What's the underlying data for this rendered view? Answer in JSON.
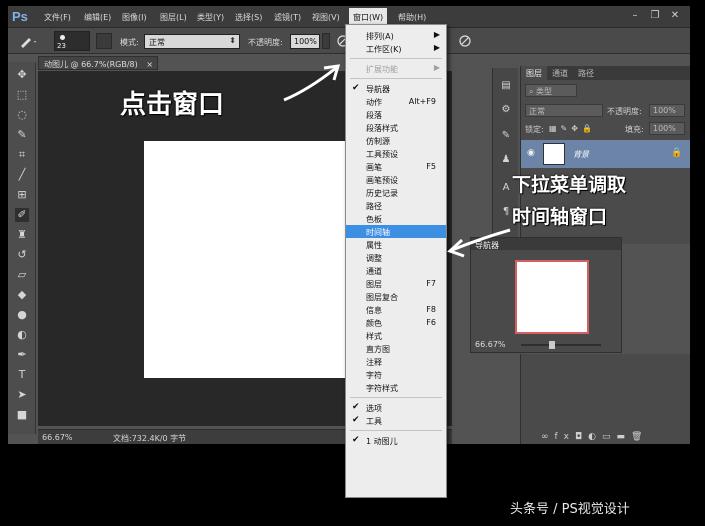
{
  "app": {
    "logo": "Ps",
    "window_controls": [
      "–",
      "❐",
      "✕"
    ]
  },
  "menubar": {
    "items": [
      {
        "label": "文件(F)"
      },
      {
        "label": "编辑(E)"
      },
      {
        "label": "图像(I)"
      },
      {
        "label": "图层(L)"
      },
      {
        "label": "类型(Y)"
      },
      {
        "label": "选择(S)"
      },
      {
        "label": "滤镜(T)"
      },
      {
        "label": "视图(V)"
      },
      {
        "label": "窗口(W)"
      },
      {
        "label": "帮助(H)"
      }
    ],
    "active_index": 8
  },
  "options": {
    "brush_size": "23",
    "mode_label": "模式:",
    "mode_value": "正常",
    "opacity_label": "不透明度:",
    "opacity_value": "100%"
  },
  "document": {
    "tab_title": "动图儿 @ 66.7%(RGB/8)",
    "zoom": "66.67%",
    "doc_info": "文档:732.4K/0 字节"
  },
  "layers_panel": {
    "tabs": [
      "图层",
      "通道",
      "路径"
    ],
    "kind_label": "类型",
    "blend_mode": "正常",
    "opacity_label": "不透明度:",
    "opacity_value": "100%",
    "lock_label": "锁定:",
    "fill_label": "填充:",
    "fill_value": "100%",
    "layer_name": "背景"
  },
  "navigator": {
    "title": "导航器",
    "zoom": "66.67%"
  },
  "window_menu": {
    "items": [
      {
        "label": "排列(A)",
        "submenu": true
      },
      {
        "label": "工作区(K)",
        "submenu": true
      },
      {
        "sep": true
      },
      {
        "label": "扩展功能",
        "submenu": true,
        "disabled": true
      },
      {
        "sep": true
      },
      {
        "label": "导航器",
        "checked": true
      },
      {
        "label": "动作",
        "shortcut": "Alt+F9"
      },
      {
        "label": "段落"
      },
      {
        "label": "段落样式"
      },
      {
        "label": "仿制源"
      },
      {
        "label": "工具预设"
      },
      {
        "label": "画笔",
        "shortcut": "F5"
      },
      {
        "label": "画笔预设"
      },
      {
        "label": "历史记录"
      },
      {
        "label": "路径"
      },
      {
        "label": "色板"
      },
      {
        "label": "时间轴",
        "highlighted": true
      },
      {
        "label": "属性"
      },
      {
        "label": "调整"
      },
      {
        "label": "通道"
      },
      {
        "label": "图层",
        "shortcut": "F7"
      },
      {
        "label": "图层复合"
      },
      {
        "label": "信息",
        "shortcut": "F8"
      },
      {
        "label": "颜色",
        "shortcut": "F6"
      },
      {
        "label": "样式"
      },
      {
        "label": "直方图"
      },
      {
        "label": "注释"
      },
      {
        "label": "字符"
      },
      {
        "label": "字符样式"
      },
      {
        "sep": true
      },
      {
        "label": "选项",
        "checked": true
      },
      {
        "label": "工具",
        "checked": true
      },
      {
        "sep": true
      },
      {
        "label": "1 动图儿",
        "checked": true
      }
    ]
  },
  "annotations": {
    "click_window": "点击窗口",
    "dropdown_line1": "下拉菜单调取",
    "dropdown_line2": "时间轴窗口"
  },
  "watermark": "头条号 / PS视觉设计"
}
